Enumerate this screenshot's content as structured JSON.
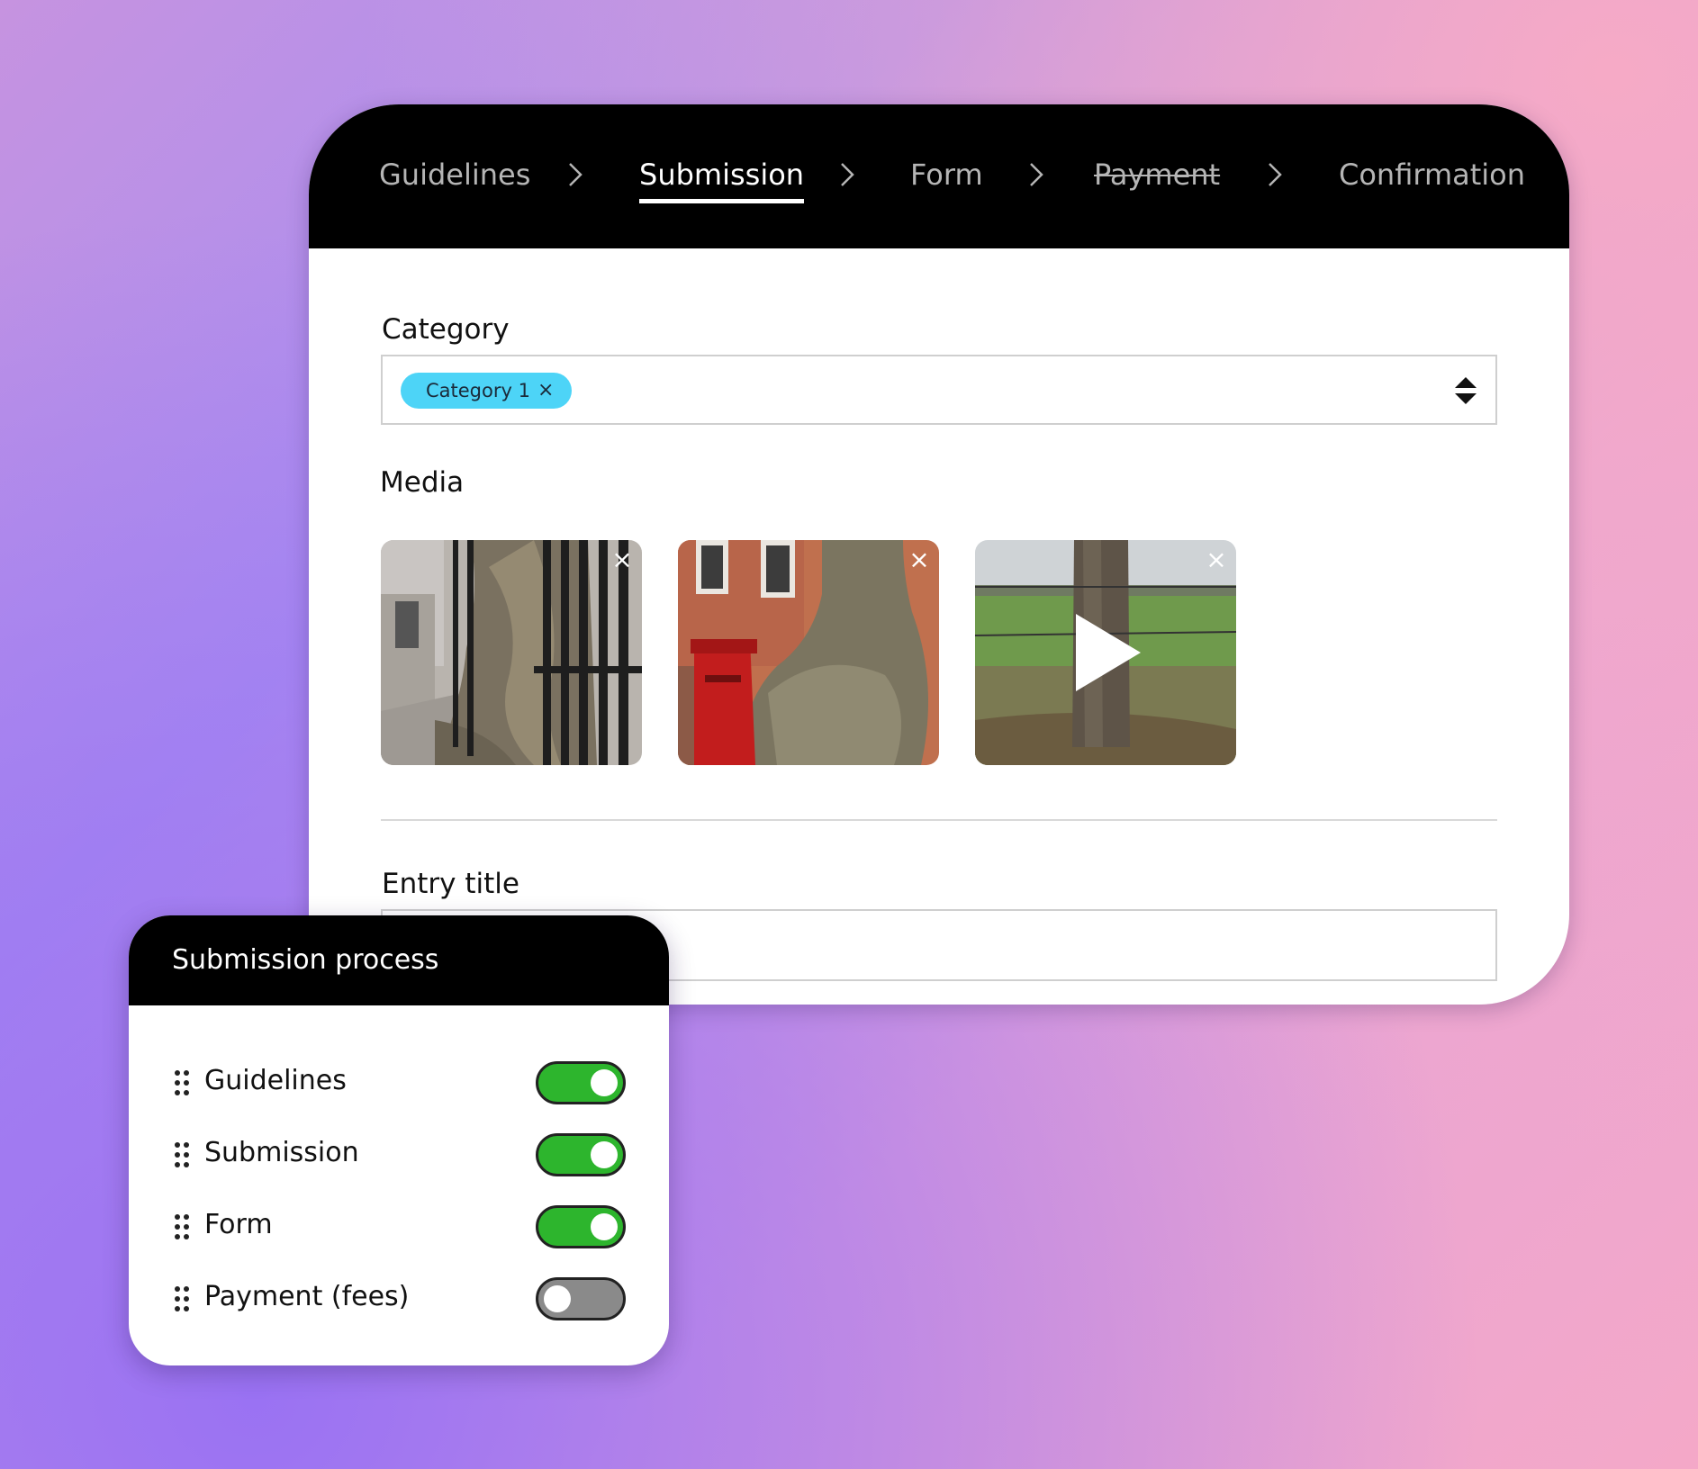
{
  "stepper": {
    "steps": [
      {
        "label": "Guidelines",
        "state": "default"
      },
      {
        "label": "Submission",
        "state": "active"
      },
      {
        "label": "Form",
        "state": "default"
      },
      {
        "label": "Payment",
        "state": "disabled"
      },
      {
        "label": "Confirmation",
        "state": "default"
      }
    ],
    "separator_icon": "chevron-right-icon"
  },
  "category": {
    "label": "Category",
    "selected_chip": "Category 1",
    "chip_remove_icon": "close-icon",
    "chip_color": "#4dd4f7",
    "dropdown_icon": "sort-updown-icon"
  },
  "media": {
    "label": "Media",
    "items": [
      {
        "type": "image",
        "remove_icon": "close-icon"
      },
      {
        "type": "image",
        "remove_icon": "close-icon"
      },
      {
        "type": "video",
        "remove_icon": "close-icon",
        "overlay_icon": "play-icon"
      }
    ]
  },
  "entry_title": {
    "label": "Entry title",
    "value": ""
  },
  "process_panel": {
    "title": "Submission process",
    "items": [
      {
        "label": "Guidelines",
        "enabled": true
      },
      {
        "label": "Submission",
        "enabled": true
      },
      {
        "label": "Form",
        "enabled": true
      },
      {
        "label": "Payment (fees)",
        "enabled": false
      }
    ],
    "on_color": "#2db52d",
    "off_color": "#8a8a8a",
    "drag_icon": "drag-handle-icon"
  }
}
